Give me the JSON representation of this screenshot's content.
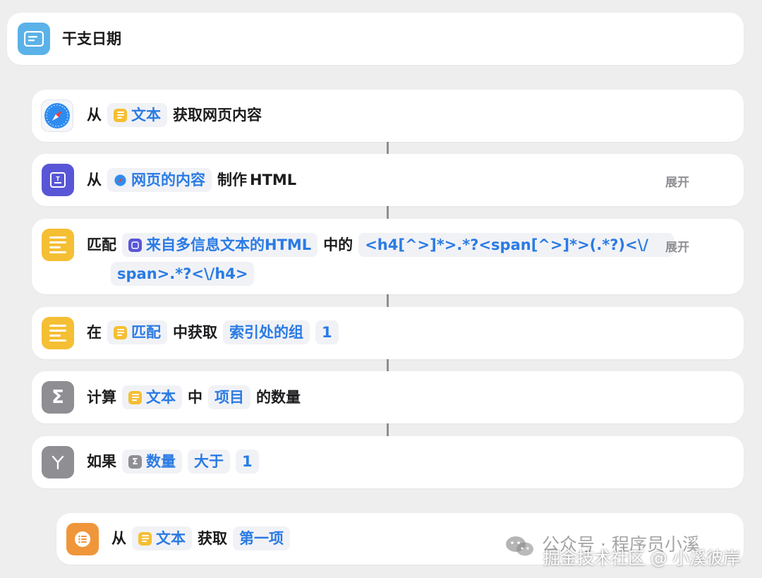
{
  "header": {
    "title": "干支日期"
  },
  "actions": [
    {
      "id": "get-web-content",
      "parts": [
        "从",
        {
          "token": "文本",
          "icon": "yellow"
        },
        "获取网页内容"
      ]
    },
    {
      "id": "make-html",
      "parts": [
        "从",
        {
          "token": "网页的内容",
          "icon": "safari"
        },
        "制作",
        "HTML"
      ],
      "expand": "展开"
    },
    {
      "id": "match",
      "parts": [
        "匹配",
        {
          "token": "来自多信息文本的HTML",
          "icon": "purple"
        },
        "中的",
        {
          "token": "<h4[^>]*>.*?<span[^>]*>(.*?)<\\/"
        }
      ],
      "continuation": "span>.*?<\\/h4>",
      "expand": "展开"
    },
    {
      "id": "get-group",
      "parts": [
        "在",
        {
          "token": "匹配",
          "icon": "yellow"
        },
        "中获取",
        {
          "token": "索引处的组"
        },
        {
          "token": "1"
        }
      ]
    },
    {
      "id": "count",
      "parts": [
        "计算",
        {
          "token": "文本",
          "icon": "yellow"
        },
        "中",
        {
          "token": "项目"
        },
        "的数量"
      ]
    },
    {
      "id": "if",
      "parts": [
        "如果",
        {
          "token": "数量",
          "icon": "sigma"
        },
        {
          "token": "大于"
        },
        {
          "token": "1"
        }
      ]
    },
    {
      "id": "get-item",
      "parts": [
        "从",
        {
          "token": "文本",
          "icon": "yellow"
        },
        "获取",
        {
          "token": "第一项"
        }
      ]
    }
  ],
  "watermark": {
    "line1": "公众号 · 程序员小溪",
    "line2": "掘金技术社区 @ 小溪彼岸"
  },
  "colors": {
    "accent": "#2a7be4",
    "token_bg": "#f1f2f6",
    "background": "#eeeeef"
  }
}
